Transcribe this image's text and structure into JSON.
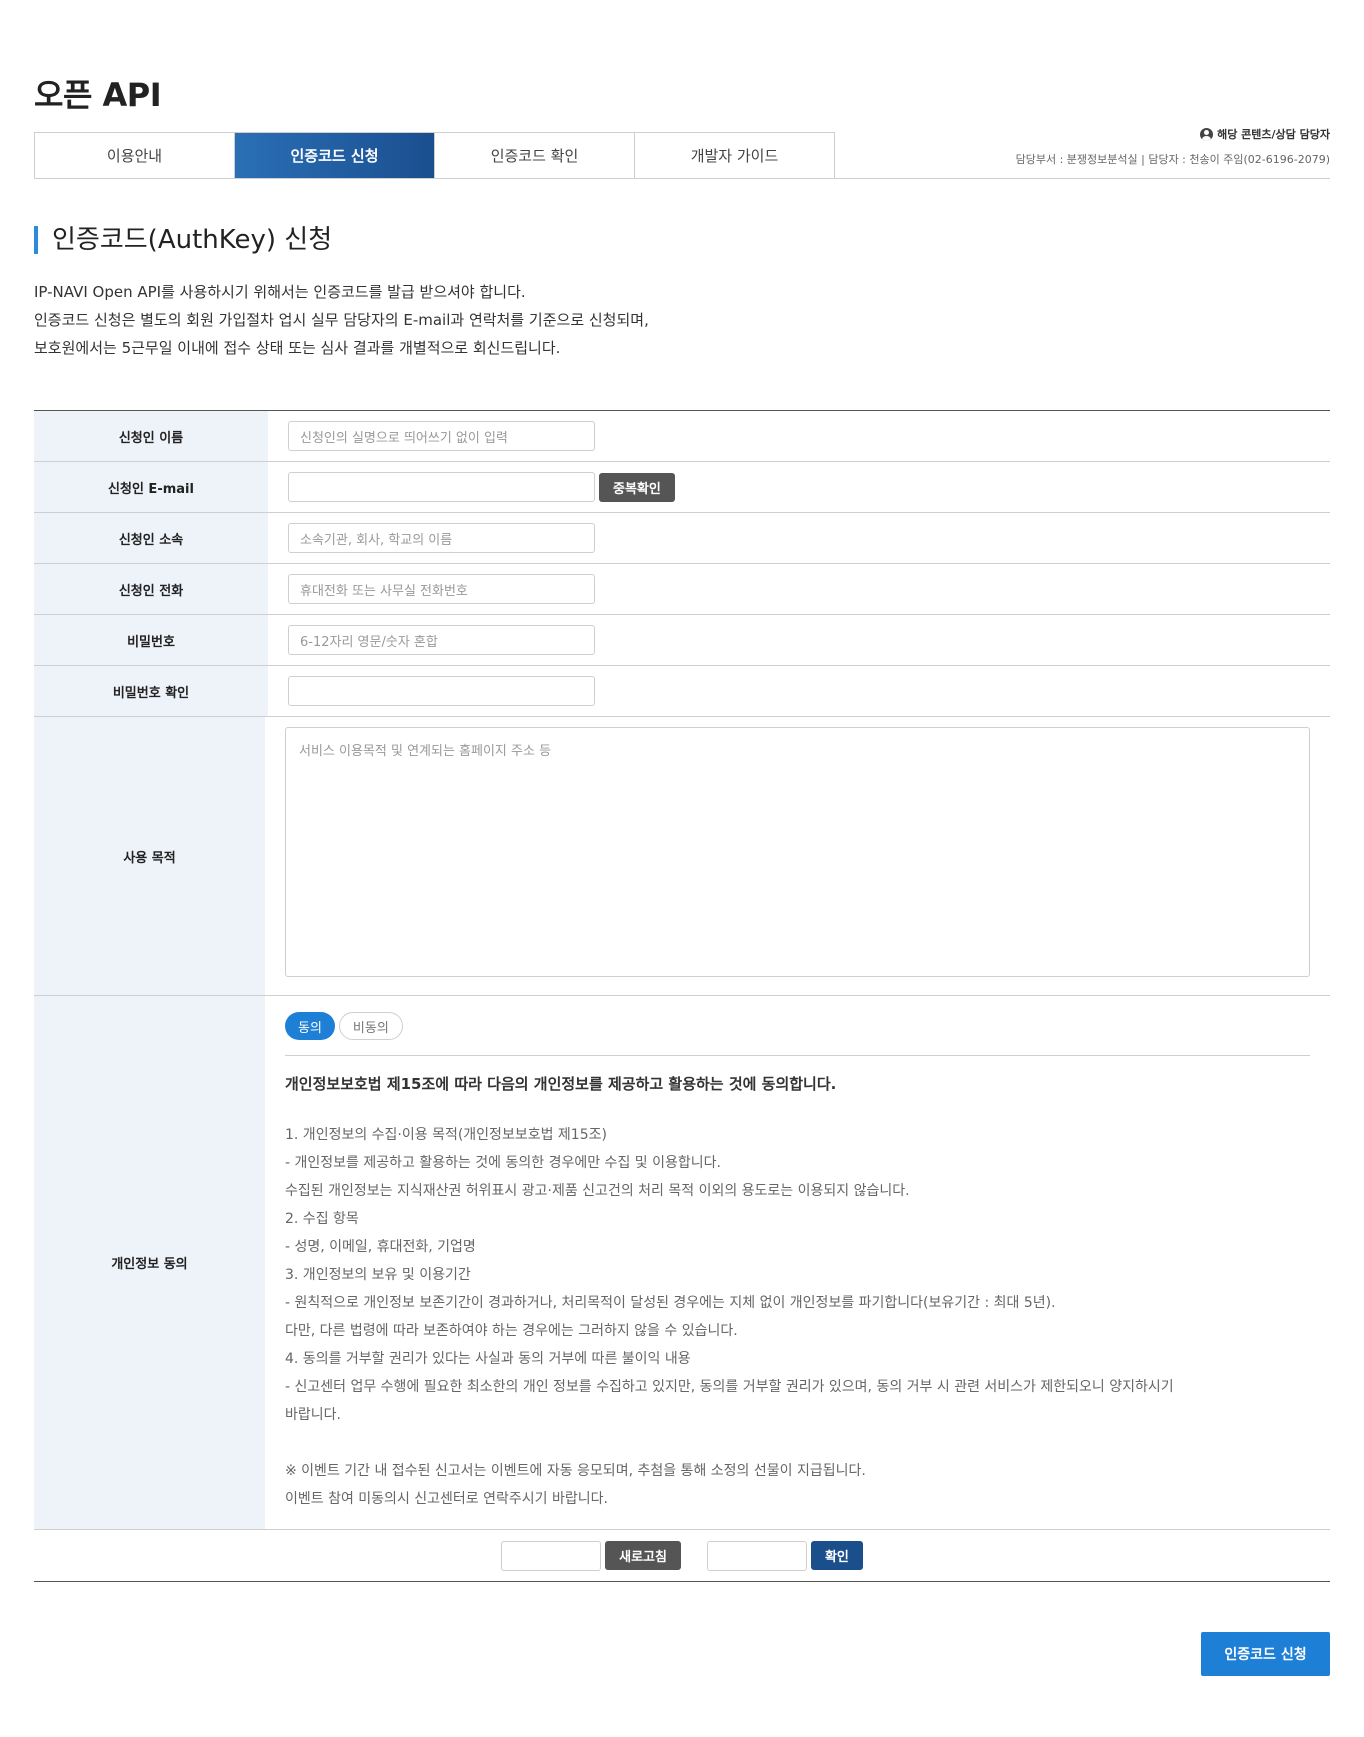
{
  "page": {
    "title": "오픈 API"
  },
  "tabs": [
    {
      "label": "이용안내",
      "active": false
    },
    {
      "label": "인증코드 신청",
      "active": true
    },
    {
      "label": "인증코드 확인",
      "active": false
    },
    {
      "label": "개발자 가이드",
      "active": false
    }
  ],
  "contact": {
    "heading": "해당 콘텐츠/상담 담당자",
    "info": "담당부서 : 분쟁정보분석실 | 담당자 : 천송이 주임(02-6196-2079)"
  },
  "section": {
    "title": "인증코드(AuthKey) 신청",
    "intro": [
      "IP-NAVI Open API를 사용하시기 위해서는 인증코드를 발급 받으셔야 합니다.",
      "인증코드 신청은 별도의 회원 가입절차 업시 실무 담당자의 E-mail과 연락처를 기준으로 신청되며,",
      "보호원에서는 5근무일 이내에 접수 상태 또는 심사 결과를 개별적으로 회신드립니다."
    ]
  },
  "form": {
    "name": {
      "label": "신청인 이름",
      "placeholder": "신청인의 실명으로 띄어쓰기 없이 입력"
    },
    "email": {
      "label": "신청인 E-mail",
      "placeholder": "",
      "dup_button": "중복확인"
    },
    "org": {
      "label": "신청인 소속",
      "placeholder": "소속기관, 회사, 학교의 이름"
    },
    "phone": {
      "label": "신청인 전화",
      "placeholder": "휴대전화 또는 사무실 전화번호"
    },
    "password": {
      "label": "비밀번호",
      "placeholder": "6-12자리 영문/숫자 혼합"
    },
    "password_confirm": {
      "label": "비밀번호 확인",
      "placeholder": ""
    },
    "purpose": {
      "label": "사용 목적",
      "placeholder": "서비스 이용목적 및 연계되는 홈페이지 주소 등"
    },
    "privacy": {
      "label": "개인정보 동의",
      "agree": "동의",
      "disagree": "비동의",
      "selected": "동의",
      "heading": "개인정보보호법 제15조에 따라 다음의 개인정보를 제공하고 활용하는 것에 동의합니다.",
      "lines": [
        "1. 개인정보의 수집·이용 목적(개인정보보호법 제15조)",
        "- 개인정보를 제공하고 활용하는 것에 동의한 경우에만 수집 및 이용합니다.",
        "수집된 개인정보는 지식재산권 허위표시 광고·제품 신고건의 처리 목적 이외의 용도로는 이용되지 않습니다.",
        "2. 수집 항목",
        "- 성명, 이메일, 휴대전화, 기업명",
        "3. 개인정보의 보유 및 이용기간",
        "- 원칙적으로 개인정보 보존기간이 경과하거나, 처리목적이 달성된 경우에는 지체 없이 개인정보를 파기합니다(보유기간 : 최대 5년).",
        "다만, 다른 법령에 따라 보존하여야 하는 경우에는 그러하지 않을 수 있습니다.",
        "4. 동의를 거부할 권리가 있다는 사실과 동의 거부에 따른 불이익 내용",
        "- 신고센터 업무 수행에 필요한 최소한의 개인 정보를 수집하고 있지만, 동의를 거부할 권리가 있으며, 동의 거부 시 관련 서비스가 제한되오니 양지하시기",
        "바랍니다.",
        "",
        "※ 이벤트 기간 내 접수된 신고서는 이벤트에 자동 응모되며, 추첨을 통해 소정의 선물이 지급됩니다.",
        "이벤트 참여 미동의시 신고센터로 연락주시기 바랍니다."
      ]
    },
    "captcha": {
      "refresh": "새로고침",
      "confirm": "확인"
    }
  },
  "submit": {
    "label": "인증코드 신청"
  },
  "colors": {
    "accent": "#1e7fd6",
    "tab_active": "#1a4f8f",
    "label_bg": "#eef3fa"
  }
}
